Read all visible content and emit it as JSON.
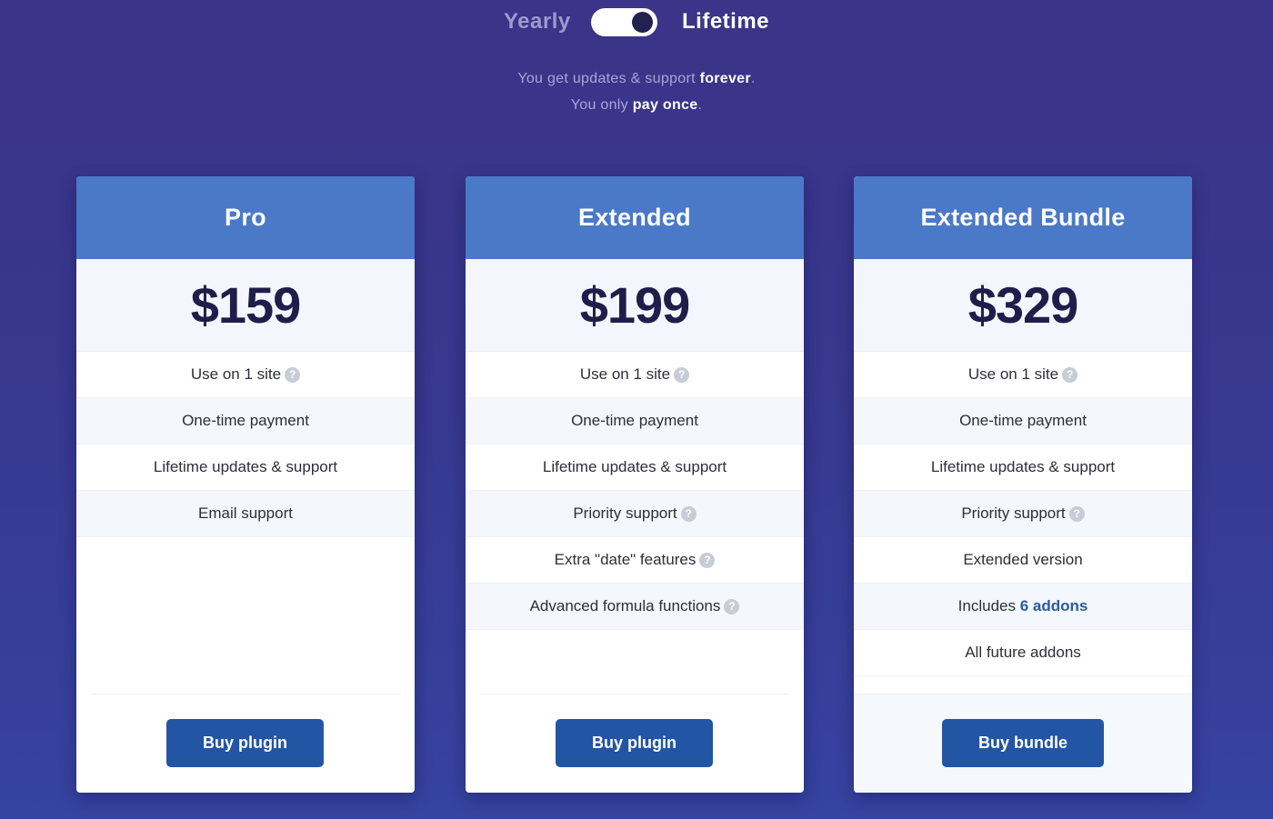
{
  "billing": {
    "yearly_label": "Yearly",
    "lifetime_label": "Lifetime",
    "selected": "Lifetime",
    "line1_pre": "You get updates & support ",
    "line1_bold": "forever",
    "line1_post": ".",
    "line2_pre": "You only ",
    "line2_bold": "pay once",
    "line2_post": "."
  },
  "colors": {
    "background": "#3b3488",
    "card_header": "#4a79c7",
    "button": "#2355a5",
    "price_text": "#1f1d4a",
    "highlight": "#2b5aa8"
  },
  "help_icon": "?",
  "plans": [
    {
      "name": "Pro",
      "price": "$159",
      "features": [
        {
          "text": "Use on 1 site",
          "help": true
        },
        {
          "text": "One-time payment",
          "help": false
        },
        {
          "text": "Lifetime updates & support",
          "help": false
        },
        {
          "text": "Email support",
          "help": false
        }
      ],
      "button": "Buy plugin"
    },
    {
      "name": "Extended",
      "price": "$199",
      "features": [
        {
          "text": "Use on 1 site",
          "help": true
        },
        {
          "text": "One-time payment",
          "help": false
        },
        {
          "text": "Lifetime updates & support",
          "help": false
        },
        {
          "text": "Priority support",
          "help": true
        },
        {
          "text": "Extra \"date\" features",
          "help": true
        },
        {
          "text": "Advanced formula functions",
          "help": true
        }
      ],
      "button": "Buy plugin"
    },
    {
      "name": "Extended Bundle",
      "price": "$329",
      "features": [
        {
          "text": "Use on 1 site",
          "help": true
        },
        {
          "text": "One-time payment",
          "help": false
        },
        {
          "text": "Lifetime updates & support",
          "help": false
        },
        {
          "text": "Priority support",
          "help": true
        },
        {
          "text": "Extended version",
          "help": false
        },
        {
          "text": "Includes ",
          "link": "6 addons",
          "help": false
        },
        {
          "text": "All future addons",
          "help": false
        }
      ],
      "button": "Buy bundle"
    }
  ]
}
